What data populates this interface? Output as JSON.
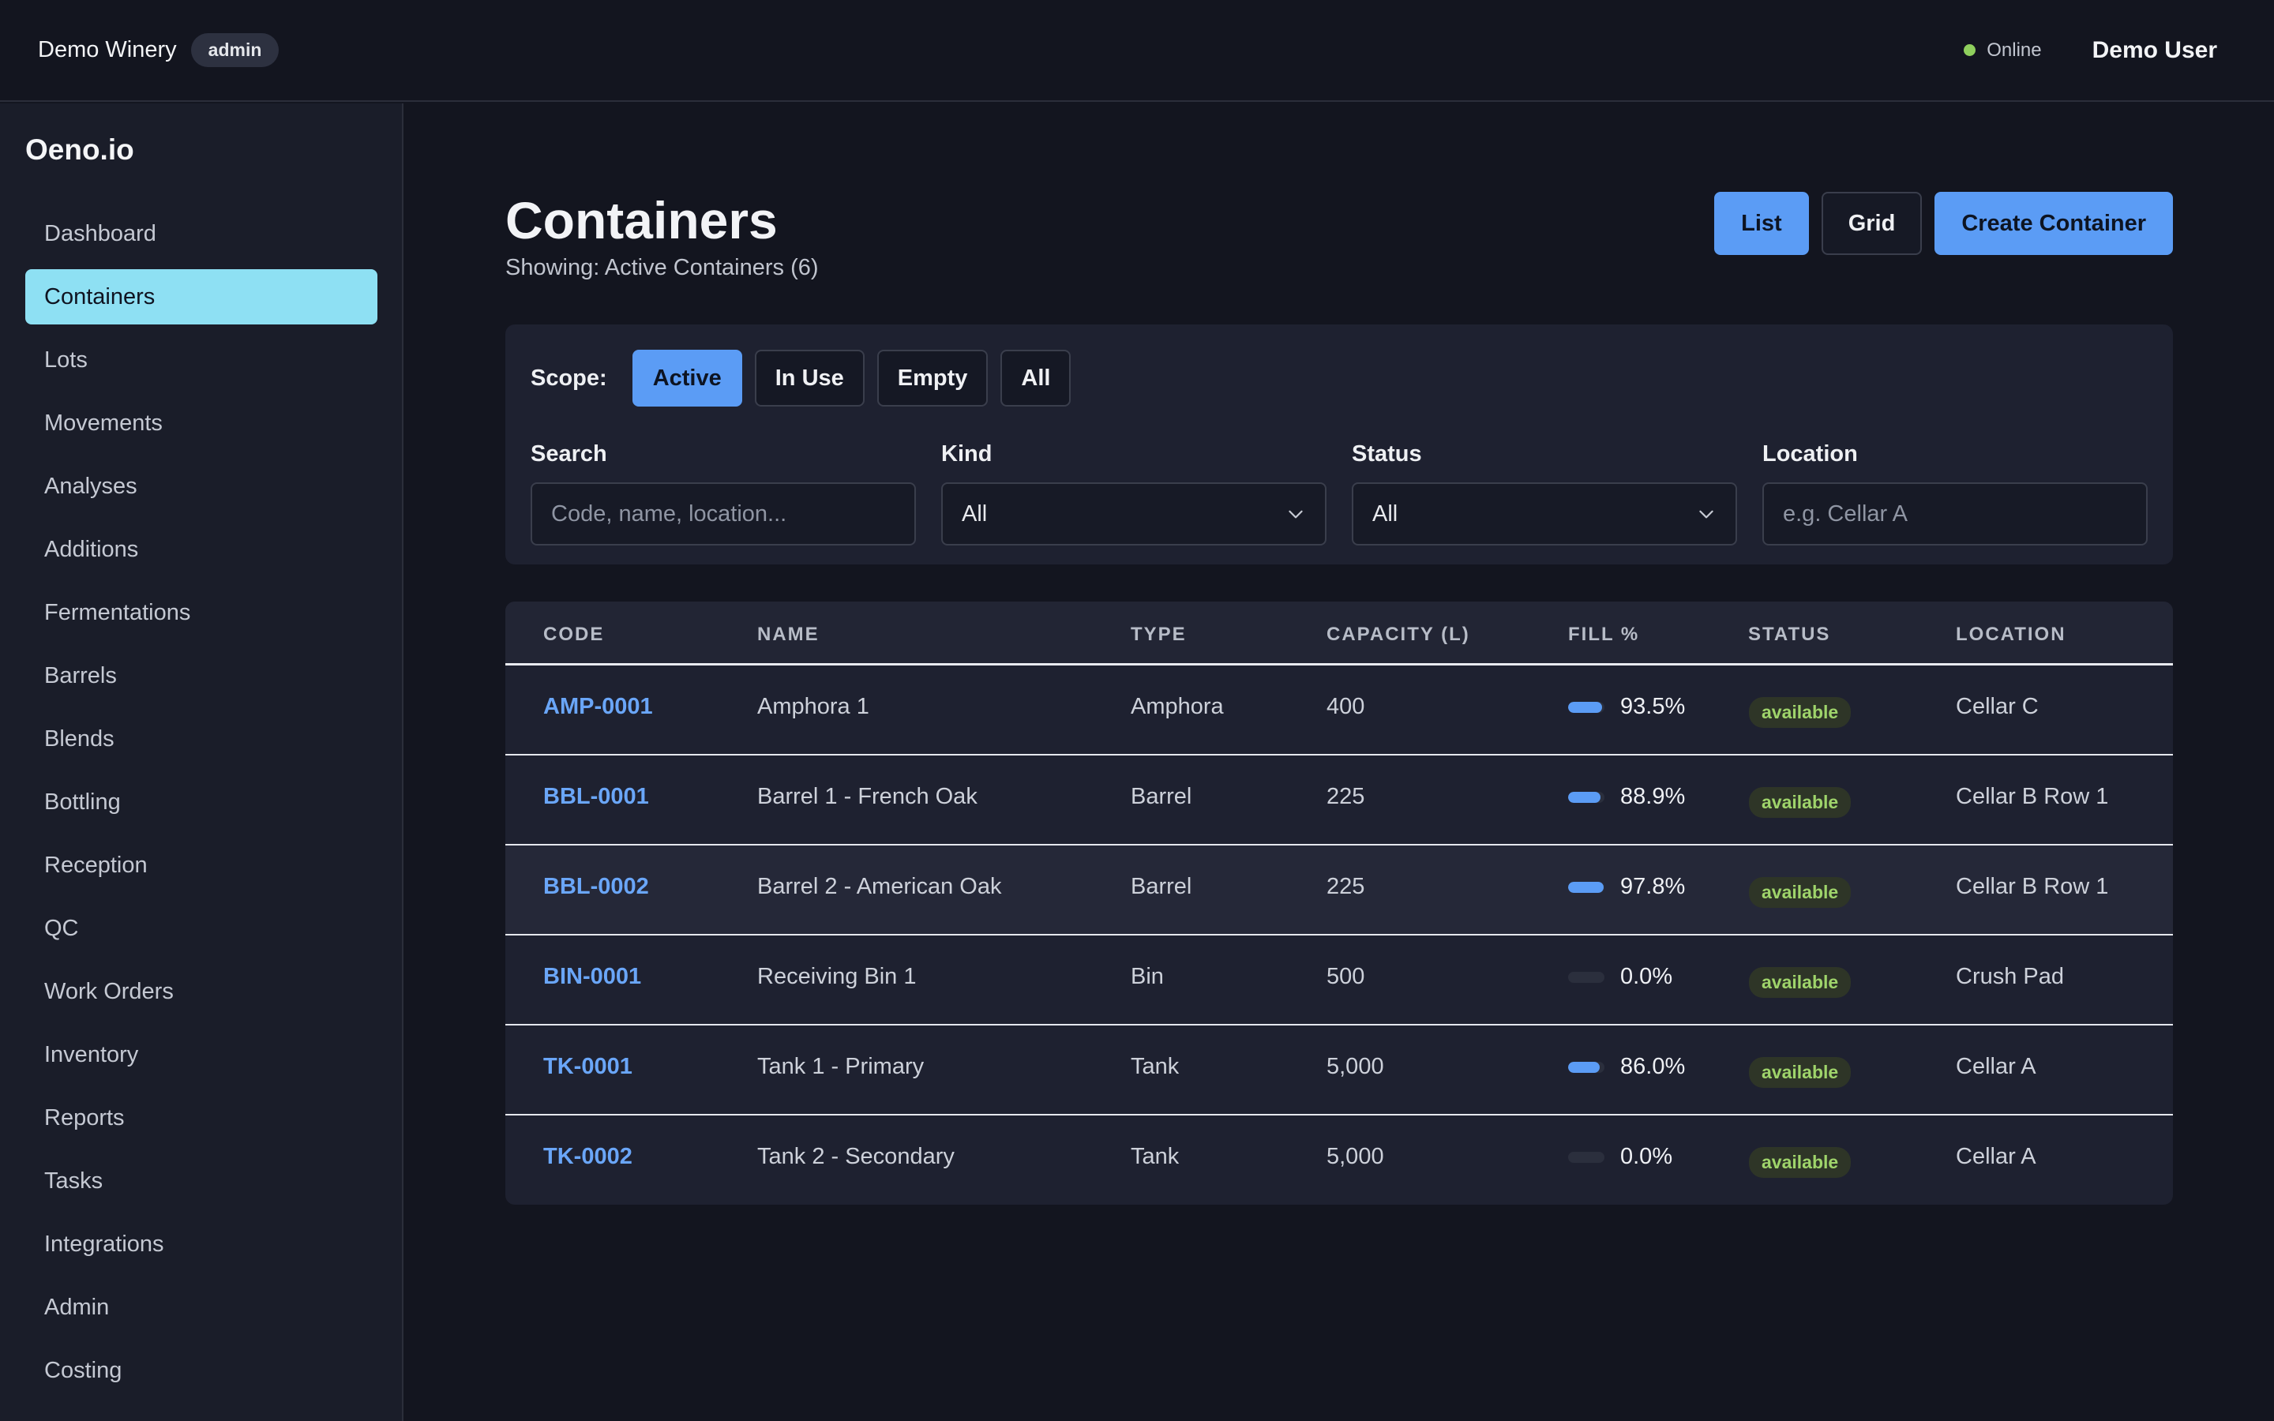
{
  "header": {
    "org": "Demo Winery",
    "role": "admin",
    "status": "Online",
    "user": "Demo User"
  },
  "sidebar": {
    "logo": "Oeno.io",
    "items": [
      {
        "label": "Dashboard",
        "active": false
      },
      {
        "label": "Containers",
        "active": true
      },
      {
        "label": "Lots",
        "active": false
      },
      {
        "label": "Movements",
        "active": false
      },
      {
        "label": "Analyses",
        "active": false
      },
      {
        "label": "Additions",
        "active": false
      },
      {
        "label": "Fermentations",
        "active": false
      },
      {
        "label": "Barrels",
        "active": false
      },
      {
        "label": "Blends",
        "active": false
      },
      {
        "label": "Bottling",
        "active": false
      },
      {
        "label": "Reception",
        "active": false
      },
      {
        "label": "QC",
        "active": false
      },
      {
        "label": "Work Orders",
        "active": false
      },
      {
        "label": "Inventory",
        "active": false
      },
      {
        "label": "Reports",
        "active": false
      },
      {
        "label": "Tasks",
        "active": false
      },
      {
        "label": "Integrations",
        "active": false
      },
      {
        "label": "Admin",
        "active": false
      },
      {
        "label": "Costing",
        "active": false
      }
    ]
  },
  "page": {
    "title": "Containers",
    "subtitle": "Showing: Active Containers (6)",
    "actions": {
      "list": "List",
      "grid": "Grid",
      "create": "Create Container"
    }
  },
  "filters": {
    "scope_label": "Scope:",
    "scopes": [
      {
        "label": "Active",
        "active": true
      },
      {
        "label": "In Use",
        "active": false
      },
      {
        "label": "Empty",
        "active": false
      },
      {
        "label": "All",
        "active": false
      }
    ],
    "search": {
      "label": "Search",
      "value": "",
      "placeholder": "Code, name, location..."
    },
    "kind": {
      "label": "Kind",
      "value": "All"
    },
    "status": {
      "label": "Status",
      "value": "All"
    },
    "location": {
      "label": "Location",
      "value": "",
      "placeholder": "e.g. Cellar A"
    }
  },
  "table": {
    "columns": [
      "CODE",
      "NAME",
      "TYPE",
      "CAPACITY (L)",
      "FILL %",
      "STATUS",
      "LOCATION"
    ],
    "rows": [
      {
        "code": "AMP-0001",
        "name": "Amphora 1",
        "type": "Amphora",
        "capacity": "400",
        "fill": "93.5%",
        "fill_value": 93.5,
        "status": "available",
        "location": "Cellar C"
      },
      {
        "code": "BBL-0001",
        "name": "Barrel 1 - French Oak",
        "type": "Barrel",
        "capacity": "225",
        "fill": "88.9%",
        "fill_value": 88.9,
        "status": "available",
        "location": "Cellar B Row 1"
      },
      {
        "code": "BBL-0002",
        "name": "Barrel 2 - American Oak",
        "type": "Barrel",
        "capacity": "225",
        "fill": "97.8%",
        "fill_value": 97.8,
        "status": "available",
        "location": "Cellar B Row 1"
      },
      {
        "code": "BIN-0001",
        "name": "Receiving Bin 1",
        "type": "Bin",
        "capacity": "500",
        "fill": "0.0%",
        "fill_value": 0,
        "status": "available",
        "location": "Crush Pad"
      },
      {
        "code": "TK-0001",
        "name": "Tank 1 - Primary",
        "type": "Tank",
        "capacity": "5,000",
        "fill": "86.0%",
        "fill_value": 86.0,
        "status": "available",
        "location": "Cellar A"
      },
      {
        "code": "TK-0002",
        "name": "Tank 2 - Secondary",
        "type": "Tank",
        "capacity": "5,000",
        "fill": "0.0%",
        "fill_value": 0,
        "status": "available",
        "location": "Cellar A"
      }
    ]
  },
  "colors": {
    "accent": "#5b9cf5",
    "active_nav": "#8ee0f3",
    "status_available": "#9fd46b",
    "online": "#8fcf5d"
  }
}
